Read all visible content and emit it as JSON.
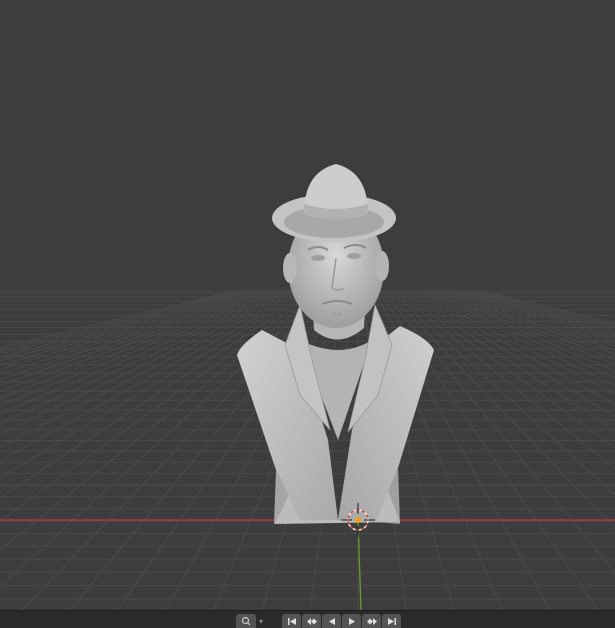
{
  "viewport": {
    "background_color": "#3d3d3d",
    "grid_color": "#4a4a4a",
    "x_axis_color": "#c0393f",
    "y_axis_color": "#6c9a2a",
    "object": "bust-sculpture",
    "object_color": "#c8c8c8"
  },
  "timeline": {
    "search_icon": "search-icon",
    "dropdown_icon": "chevron-down-icon",
    "playback_buttons": [
      {
        "name": "jump-to-start-icon"
      },
      {
        "name": "jump-to-keyframe-back-icon"
      },
      {
        "name": "play-reverse-icon"
      },
      {
        "name": "play-icon"
      },
      {
        "name": "jump-to-keyframe-forward-icon"
      },
      {
        "name": "jump-to-end-icon"
      }
    ]
  }
}
